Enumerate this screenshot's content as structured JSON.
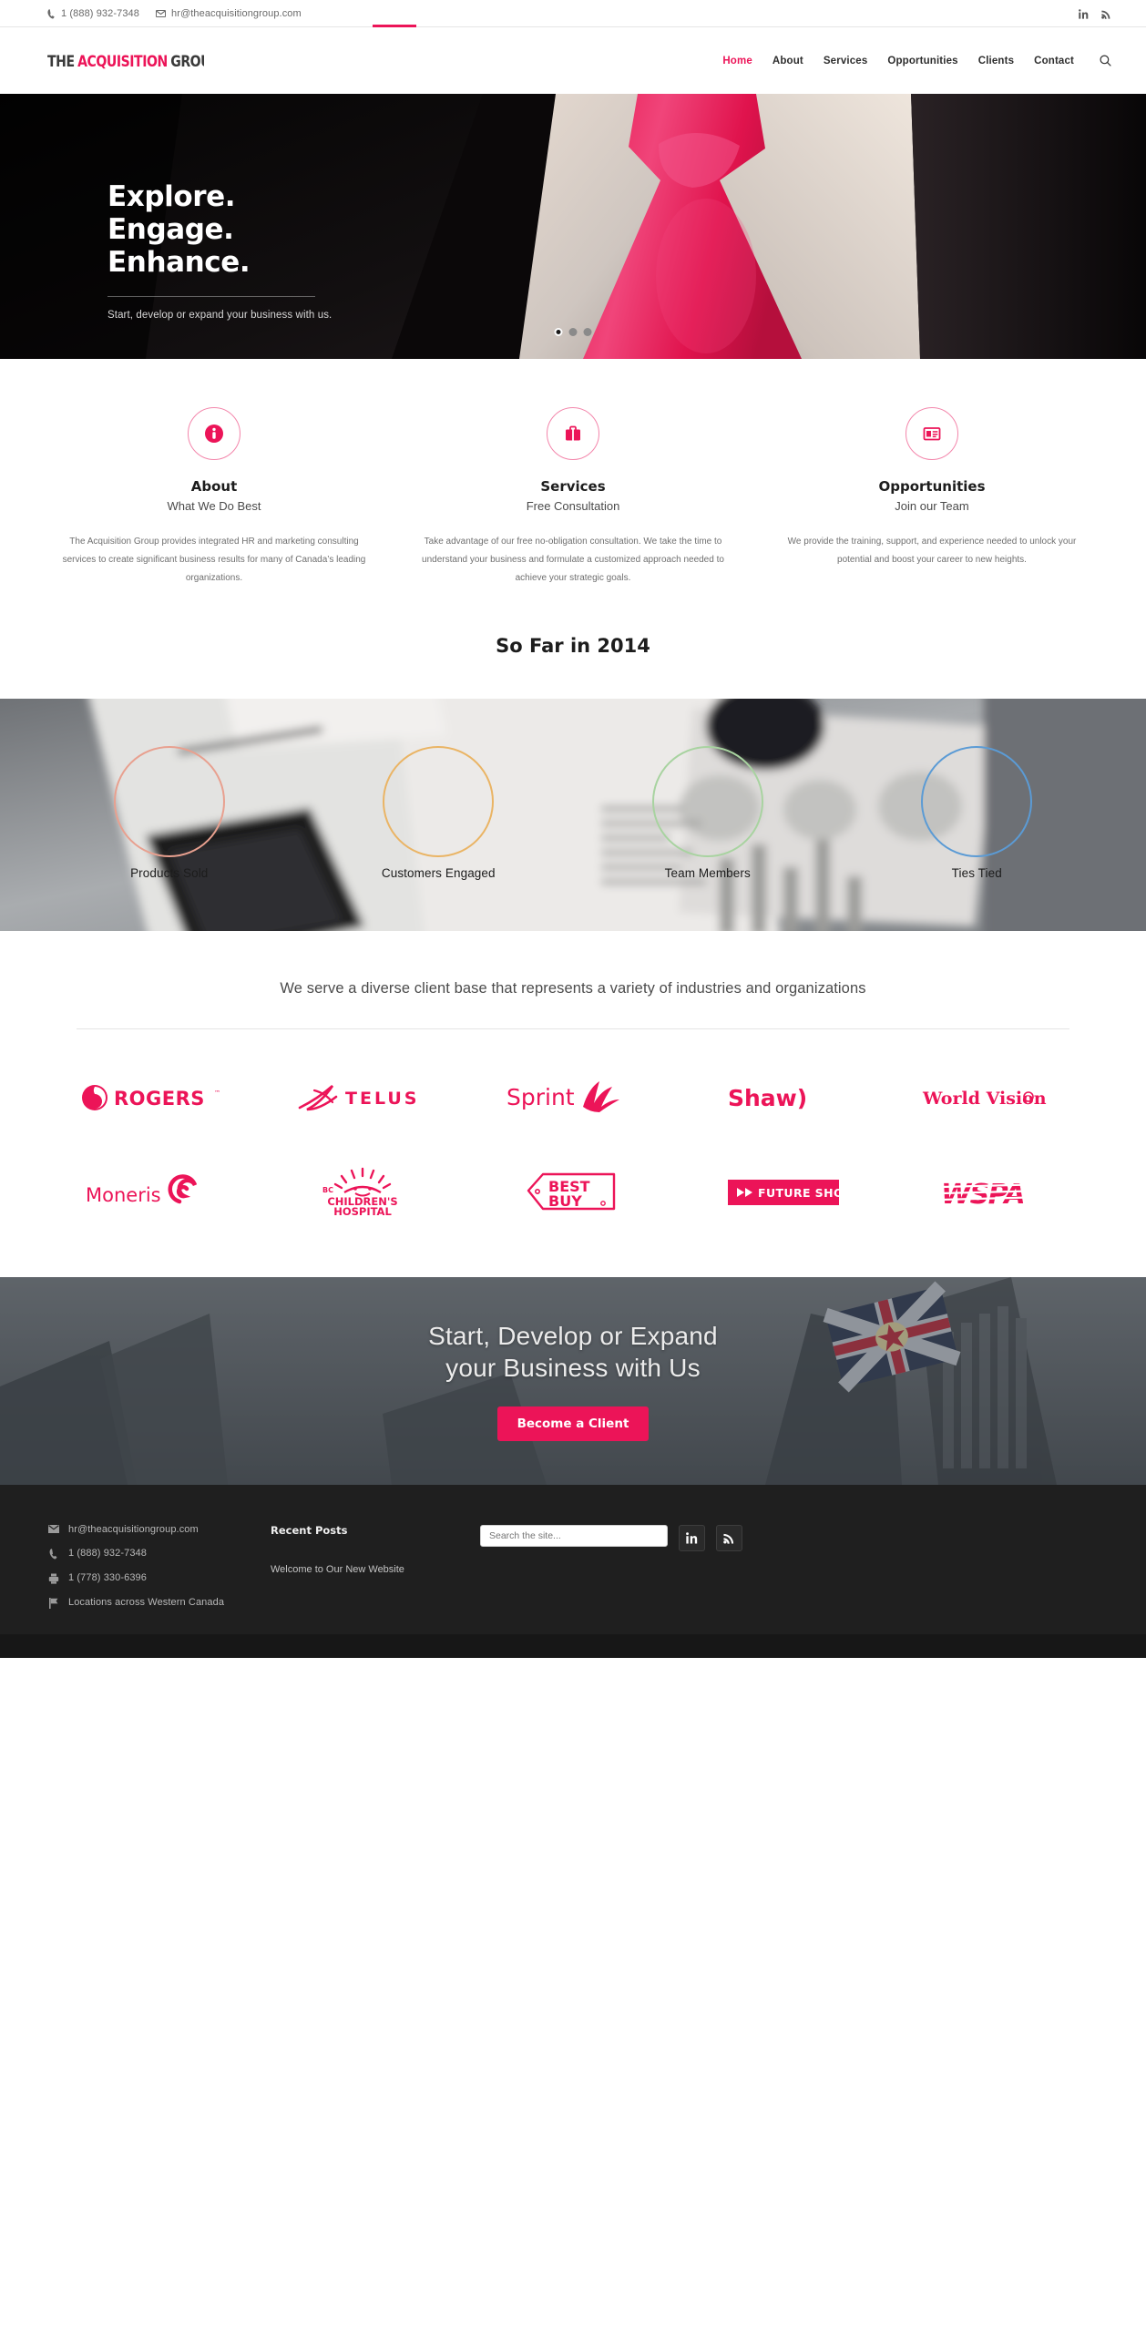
{
  "topbar": {
    "phone": "1 (888) 932-7348",
    "email": "hr@theacquisitiongroup.com",
    "phone_icon": "phone-icon",
    "email_icon": "envelope-icon",
    "social": [
      {
        "name": "linkedin-icon",
        "label": "in"
      },
      {
        "name": "rss-icon",
        "label": "rss"
      }
    ]
  },
  "header": {
    "logo_alt": "THE ACQUISITION GROUP",
    "logo_part1": "THE",
    "logo_part2": "ACQUISITION",
    "logo_part3": "GROUP",
    "nav": [
      {
        "label": "Home",
        "active": true
      },
      {
        "label": "About",
        "active": false
      },
      {
        "label": "Services",
        "active": false
      },
      {
        "label": "Opportunities",
        "active": false
      },
      {
        "label": "Clients",
        "active": false
      },
      {
        "label": "Contact",
        "active": false
      }
    ],
    "search_icon": "search-icon"
  },
  "hero": {
    "line1": "Explore.",
    "line2": "Engage.",
    "line3": "Enhance.",
    "subtitle": "Start, develop or expand your business with us.",
    "slides": 3,
    "active_slide": 1
  },
  "features": [
    {
      "icon": "info-circle-icon",
      "title": "About",
      "subtitle": "What We Do Best",
      "body": "The Acquisition Group provides integrated HR and marketing consulting services to create significant business results for many of Canada’s leading organizations."
    },
    {
      "icon": "briefcase-icon",
      "title": "Services",
      "subtitle": "Free Consultation",
      "body": "Take advantage of our free no-obligation consultation. We take the time to understand your business and formulate a customized approach needed to achieve your strategic goals."
    },
    {
      "icon": "id-card-icon",
      "title": "Opportunities",
      "subtitle": "Join our Team",
      "body": "We provide the training, support, and experience needed to unlock your potential and boost your career to new heights."
    }
  ],
  "counters_section": {
    "title": "So Far in 2014",
    "items": [
      {
        "label": "Products Sold",
        "value": "",
        "color": "#e8a08f"
      },
      {
        "label": "Customers Engaged",
        "value": "",
        "color": "#eab464"
      },
      {
        "label": "Team Members",
        "value": "",
        "color": "#a8d3a0"
      },
      {
        "label": "Ties Tied",
        "value": "",
        "color": "#5b9bd5"
      }
    ]
  },
  "clients": {
    "intro": "We serve a diverse client base that represents a variety of industries and organizations",
    "row1": [
      {
        "name": "rogers-logo",
        "label": "ROGERS"
      },
      {
        "name": "telus-logo",
        "label": "TELUS"
      },
      {
        "name": "sprint-logo",
        "label": "Sprint"
      },
      {
        "name": "shaw-logo",
        "label": "Shaw)"
      },
      {
        "name": "world-vision-logo",
        "label": "World Vision"
      }
    ],
    "row2": [
      {
        "name": "moneris-logo",
        "label": "Moneris"
      },
      {
        "name": "bc-childrens-hospital-logo",
        "label": "BC CHILDREN'S HOSPITAL"
      },
      {
        "name": "best-buy-logo",
        "label": "BEST BUY"
      },
      {
        "name": "future-shop-logo",
        "label": "FUTURE SHOP"
      },
      {
        "name": "wspa-logo",
        "label": "WSPA"
      }
    ]
  },
  "cta": {
    "line1": "Start, Develop or Expand",
    "line2": "your Business with Us",
    "button": "Become a Client"
  },
  "footer": {
    "contact": [
      {
        "icon": "envelope-icon",
        "text": "hr@theacquisitiongroup.com"
      },
      {
        "icon": "phone-icon",
        "text": "1 (888) 932-7348"
      },
      {
        "icon": "fax-icon",
        "text": "1 (778) 330-6396"
      },
      {
        "icon": "flag-icon",
        "text": "Locations across Western Canada"
      }
    ],
    "posts_title": "Recent Posts",
    "posts": [
      "Welcome to Our New Website"
    ],
    "search_placeholder": "Search the site...",
    "social": [
      {
        "name": "linkedin-icon",
        "label": "in"
      },
      {
        "name": "rss-icon",
        "label": "rss"
      }
    ]
  },
  "colors": {
    "accent": "#ec1458",
    "accent_light": "#f386ab",
    "dark": "#1f1f1f",
    "darker": "#171717"
  }
}
